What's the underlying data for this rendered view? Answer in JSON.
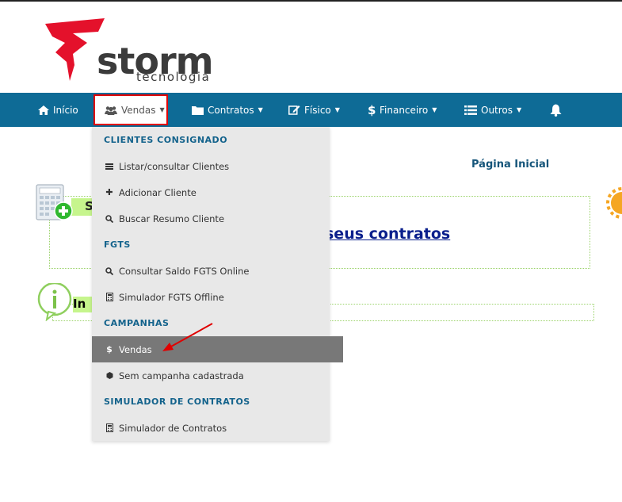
{
  "logo": {
    "word": "storm",
    "sub": "tecnologia"
  },
  "nav": {
    "items": [
      {
        "label": "Início",
        "icon": "home-icon"
      },
      {
        "label": "Vendas",
        "icon": "users-icon"
      },
      {
        "label": "Contratos",
        "icon": "folder-icon"
      },
      {
        "label": "Físico",
        "icon": "edit-icon"
      },
      {
        "label": "Financeiro",
        "icon": "dollar-icon"
      },
      {
        "label": "Outros",
        "icon": "list-icon"
      }
    ],
    "bell_icon": "bell-icon",
    "color": "#0e6b96",
    "highlight_color": "#e00000"
  },
  "page": {
    "title": "Página Inicial",
    "section_letter": "S",
    "link_text": "seus contratos",
    "section2_text": "In"
  },
  "dropdown": {
    "sections": [
      {
        "header": "CLIENTES CONSIGNADO",
        "items": [
          {
            "label": "Listar/consultar Clientes",
            "icon": "list-icon"
          },
          {
            "label": "Adicionar Cliente",
            "icon": "plus-icon"
          },
          {
            "label": "Buscar Resumo Cliente",
            "icon": "search-icon"
          }
        ]
      },
      {
        "header": "FGTS",
        "items": [
          {
            "label": "Consultar Saldo FGTS Online",
            "icon": "search-icon"
          },
          {
            "label": "Simulador FGTS Offline",
            "icon": "calculator-icon"
          }
        ]
      },
      {
        "header": "CAMPANHAS",
        "items": [
          {
            "label": "Vendas",
            "icon": "dollar-icon",
            "active": true
          },
          {
            "label": "Sem campanha cadastrada",
            "icon": "circle-icon"
          }
        ]
      },
      {
        "header": "SIMULADOR DE CONTRATOS",
        "items": [
          {
            "label": "Simulador de Contratos",
            "icon": "calculator-icon"
          }
        ]
      }
    ]
  }
}
